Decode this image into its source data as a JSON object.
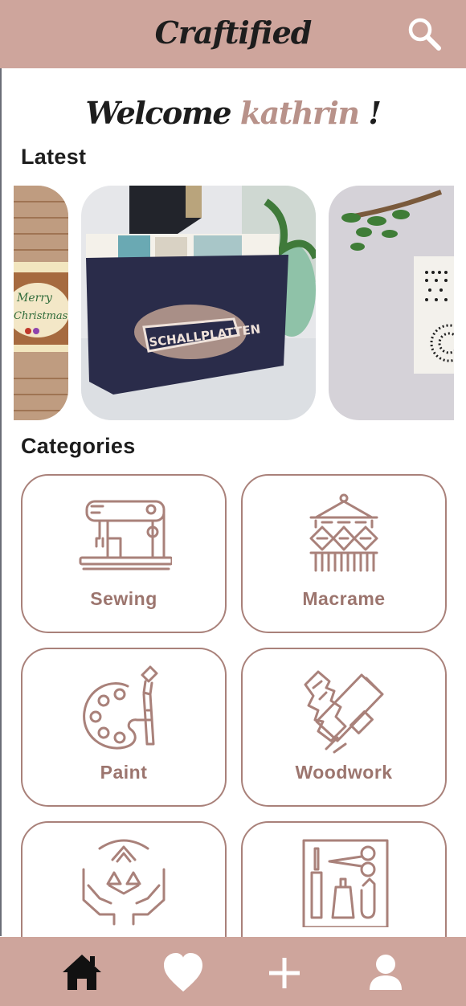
{
  "app": {
    "title": "Craftified"
  },
  "header": {
    "search_icon": "search-icon"
  },
  "welcome": {
    "prefix": "Welcome",
    "username": "kathrin",
    "suffix": "!"
  },
  "latest": {
    "heading": "Latest",
    "cards": [
      {
        "name": "christmas-card-craft",
        "text": "Merry Christmas"
      },
      {
        "name": "record-storage-box-craft",
        "text": "SCHALLPLATTEN"
      },
      {
        "name": "dot-art-wall-hanging-craft"
      }
    ]
  },
  "categories": {
    "heading": "Categories",
    "items": [
      {
        "label": "Sewing",
        "icon": "sewing-machine-icon"
      },
      {
        "label": "Macrame",
        "icon": "macrame-icon"
      },
      {
        "label": "Paint",
        "icon": "paint-palette-icon"
      },
      {
        "label": "Woodwork",
        "icon": "woodwork-icon"
      },
      {
        "label": "",
        "icon": "recycle-hands-icon"
      },
      {
        "label": "",
        "icon": "craft-tools-icon"
      }
    ]
  },
  "bottom_nav": {
    "items": [
      {
        "name": "home",
        "icon": "home-icon",
        "active": true
      },
      {
        "name": "favorites",
        "icon": "heart-icon"
      },
      {
        "name": "add",
        "icon": "plus-icon"
      },
      {
        "name": "profile",
        "icon": "user-icon"
      }
    ]
  },
  "colors": {
    "bar": "#cea59c",
    "accent": "#b8928a",
    "icon_stroke": "#a9817a",
    "text_dark": "#1d1d1d",
    "active_nav": "#111111",
    "inactive_nav": "#ffffff"
  }
}
